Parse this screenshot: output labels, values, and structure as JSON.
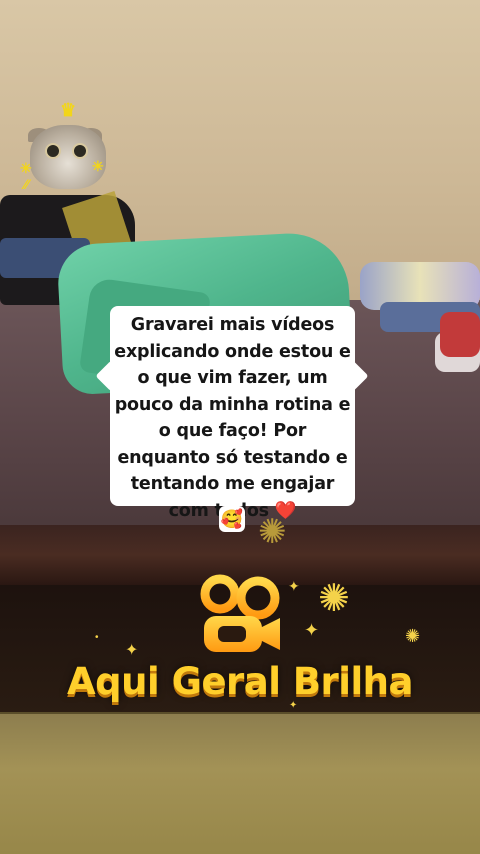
{
  "caption": {
    "text": "Gravarei mais vídeos explicando onde estou e o que vim fazer, um pouco da minha rotina e o que faço! Por enquanto só testando e tentando me engajar com todos",
    "heart": "❤️",
    "tail_emoji": "🥰"
  },
  "branding": {
    "logo_icon": "kwai-camera-logo",
    "slogan": "Aqui Geral Brilha"
  },
  "colors": {
    "caption_bg": "#ffffff",
    "caption_text": "#161616",
    "brand_yellow": "#ffcf2b",
    "brand_shadow": "#c27a0c",
    "heart": "#e0202a"
  }
}
